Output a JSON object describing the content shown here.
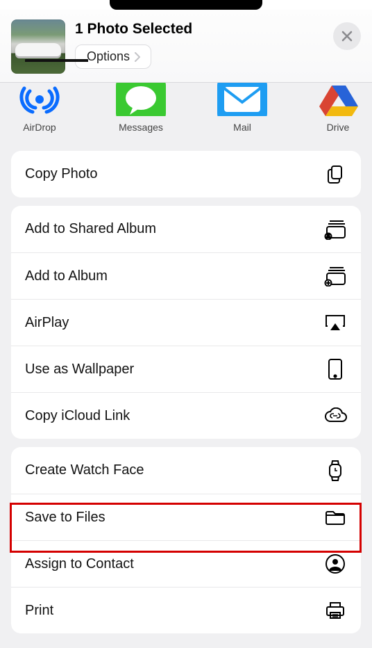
{
  "header": {
    "title": "1 Photo Selected",
    "options_label": "Options"
  },
  "share_targets": {
    "airdrop": "AirDrop",
    "messages": "Messages",
    "mail": "Mail",
    "drive": "Drive"
  },
  "actions": {
    "group1": {
      "copy_photo": "Copy Photo"
    },
    "group2": {
      "add_shared_album": "Add to Shared Album",
      "add_album": "Add to Album",
      "airplay": "AirPlay",
      "wallpaper": "Use as Wallpaper",
      "copy_icloud": "Copy iCloud Link"
    },
    "group3": {
      "watch_face": "Create Watch Face",
      "save_files": "Save to Files",
      "assign_contact": "Assign to Contact",
      "print": "Print"
    }
  }
}
